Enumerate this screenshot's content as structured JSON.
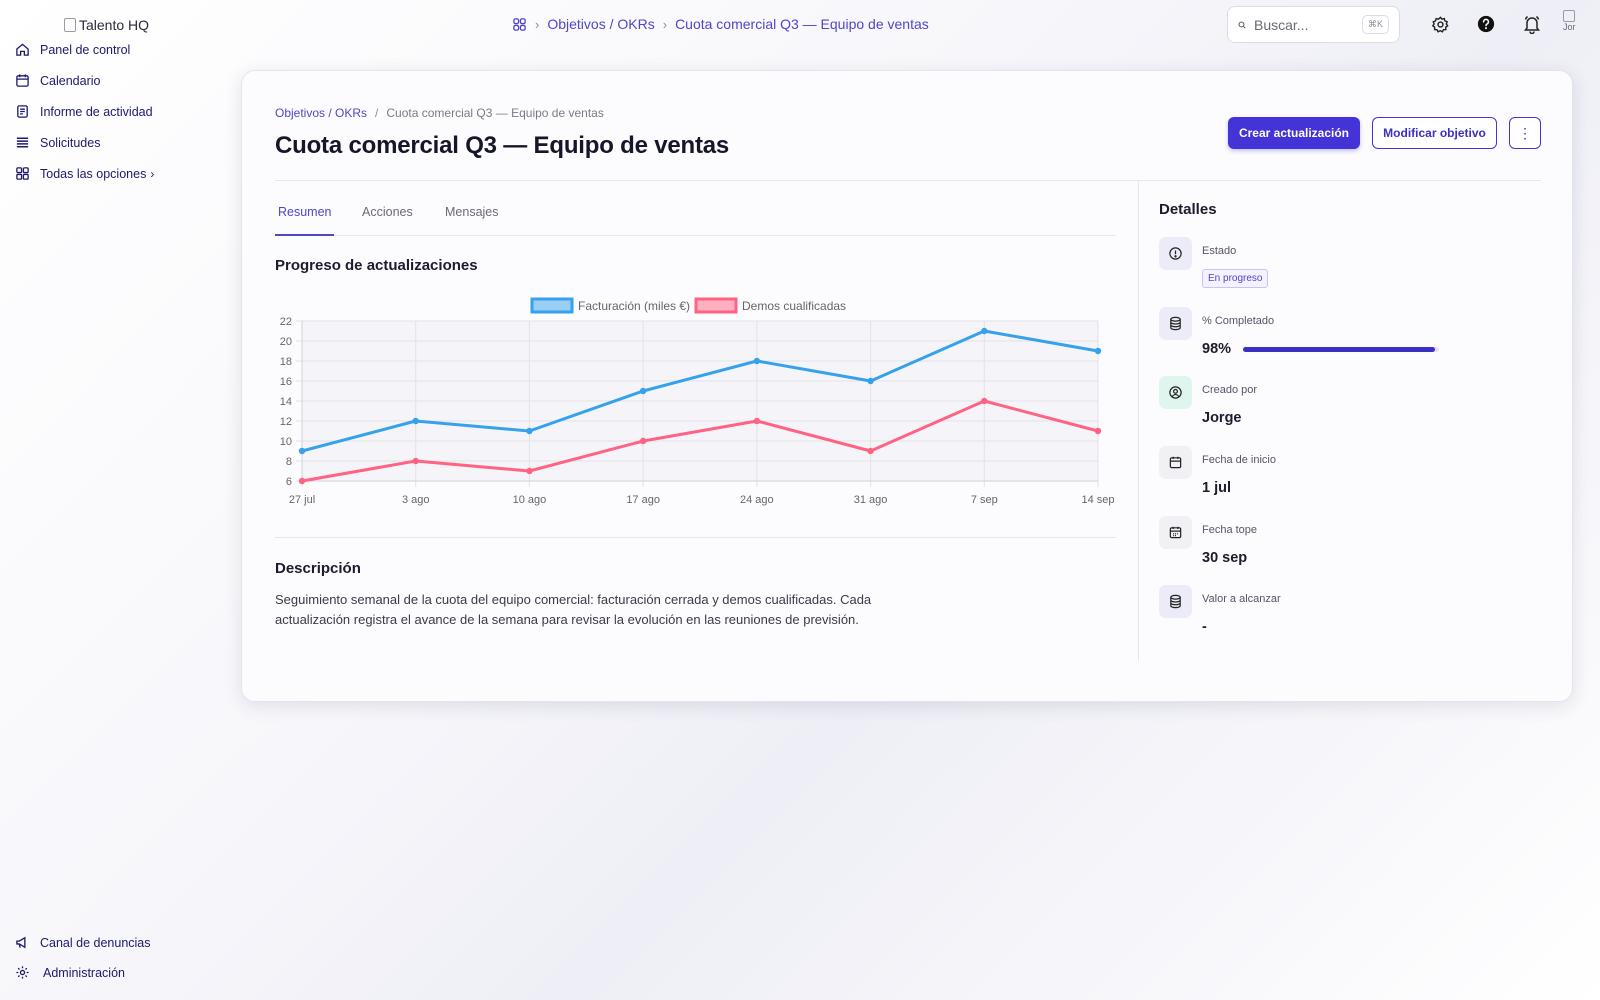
{
  "app": {
    "logo_alt": "Talento HQ"
  },
  "sidebar": {
    "items": [
      {
        "label": "Panel de control",
        "icon": "home-icon"
      },
      {
        "label": "Calendario",
        "icon": "calendar-icon"
      },
      {
        "label": "Informe de actividad",
        "icon": "report-icon"
      },
      {
        "label": "Solicitudes",
        "icon": "list-icon"
      },
      {
        "label": "Todas las opciones",
        "icon": "grid-icon"
      }
    ],
    "bottom": [
      {
        "label": "Canal de denuncias",
        "icon": "megaphone-icon"
      },
      {
        "label": "Administración",
        "icon": "gear-icon"
      }
    ]
  },
  "topbar": {
    "breadcrumb": [
      "Objetivos / OKRs",
      "Cuota comercial Q3 — Equipo de ventas"
    ],
    "search_placeholder": "Buscar...",
    "search_shortcut": "⌘K",
    "avatar_alt": "Jor"
  },
  "page": {
    "breadcrumb": {
      "parent": "Objetivos / OKRs",
      "separator": "/",
      "current": "Cuota comercial Q3 — Equipo de ventas"
    },
    "title": "Cuota comercial Q3 — Equipo de ventas",
    "actions": {
      "primary": "Crear actualización",
      "secondary": "Modificar objetivo",
      "more": "⋮"
    },
    "tabs": [
      {
        "label": "Resumen",
        "active": true
      },
      {
        "label": "Acciones",
        "active": false
      },
      {
        "label": "Mensajes",
        "active": false
      }
    ],
    "progress_title": "Progreso de actualizaciones",
    "description_title": "Descripción",
    "description": "Seguimiento semanal de la cuota del equipo comercial: facturación cerrada y demos cualificadas. Cada actualización registra el avance de la semana para revisar la evolución en las reuniones de previsión."
  },
  "details": {
    "title": "Detalles",
    "estado": {
      "label": "Estado",
      "value": "En progreso"
    },
    "completado": {
      "label": "% Completado",
      "value": "98%",
      "fraction": 0.98
    },
    "creado": {
      "label": "Creado por",
      "value": "Jorge"
    },
    "inicio": {
      "label": "Fecha de inicio",
      "value": "1 jul"
    },
    "tope": {
      "label": "Fecha tope",
      "value": "30 sep"
    },
    "valor": {
      "label": "Valor a alcanzar",
      "value": "-"
    }
  },
  "colors": {
    "accent": "#4433d6",
    "series1": "#36a2eb",
    "series2": "#ff6384"
  },
  "chart_data": {
    "type": "line",
    "categories": [
      "27 jul",
      "3 ago",
      "10 ago",
      "17 ago",
      "24 ago",
      "31 ago",
      "7 sep",
      "14 sep"
    ],
    "series": [
      {
        "name": "Facturación (miles €)",
        "values": [
          9,
          12,
          11,
          15,
          18,
          16,
          21,
          19
        ],
        "color": "#36a2eb"
      },
      {
        "name": "Demos cualificadas",
        "values": [
          6,
          8,
          7,
          10,
          12,
          9,
          14,
          11
        ],
        "color": "#ff6384"
      }
    ],
    "yticks": [
      6,
      8,
      10,
      12,
      14,
      16,
      18,
      20,
      22
    ],
    "ylim": [
      6,
      22
    ],
    "grid": true,
    "legend": "top-center"
  }
}
